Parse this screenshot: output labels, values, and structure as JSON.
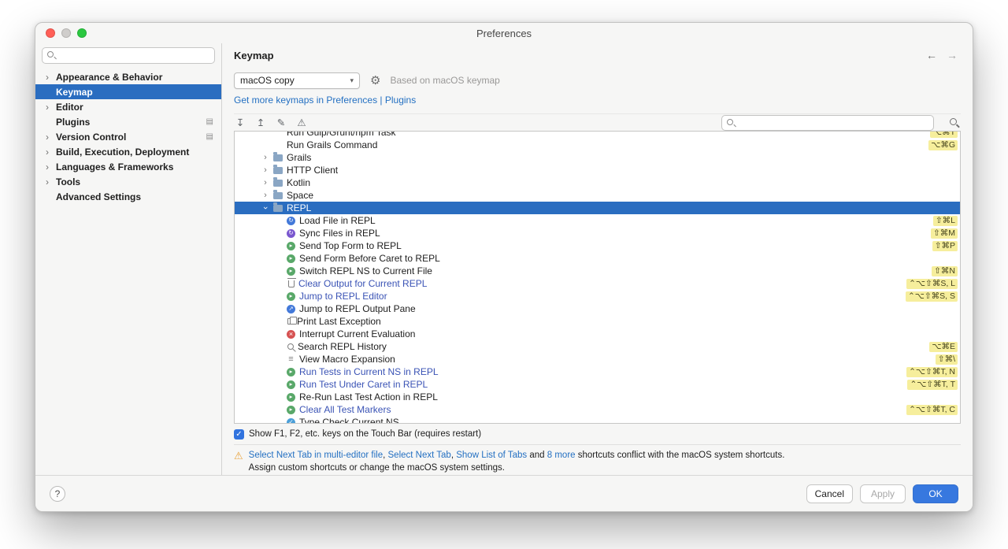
{
  "window": {
    "title": "Preferences"
  },
  "sidebar": {
    "search_placeholder": "",
    "items": [
      {
        "label": "Appearance & Behavior",
        "chevron": true,
        "selected": false
      },
      {
        "label": "Keymap",
        "chevron": false,
        "selected": true
      },
      {
        "label": "Editor",
        "chevron": true,
        "selected": false
      },
      {
        "label": "Plugins",
        "chevron": false,
        "selected": false,
        "trailing_icon": "plugin-list-icon"
      },
      {
        "label": "Version Control",
        "chevron": true,
        "selected": false,
        "trailing_icon": "plugin-list-icon"
      },
      {
        "label": "Build, Execution, Deployment",
        "chevron": true,
        "selected": false
      },
      {
        "label": "Languages & Frameworks",
        "chevron": true,
        "selected": false
      },
      {
        "label": "Tools",
        "chevron": true,
        "selected": false
      },
      {
        "label": "Advanced Settings",
        "chevron": false,
        "selected": false
      }
    ]
  },
  "header": {
    "title": "Keymap",
    "back_icon": "←",
    "forward_icon": "→"
  },
  "keymap": {
    "scheme": "macOS copy",
    "based_on": "Based on macOS keymap",
    "more_link": "Get more keymaps in Preferences | Plugins"
  },
  "toolbar": {
    "icons": [
      "expand-all",
      "collapse-all",
      "edit-shortcut",
      "show-conflicts"
    ],
    "search_placeholder": ""
  },
  "tree": {
    "rows": [
      {
        "kind": "action",
        "label": "Run Gulp/Grunt/npm Task",
        "shortcut": "⌥⌘T",
        "clipped": "top"
      },
      {
        "kind": "action",
        "label": "Run Grails Command",
        "shortcut": "⌥⌘G"
      },
      {
        "kind": "folder",
        "label": "Grails"
      },
      {
        "kind": "folder",
        "label": "HTTP Client"
      },
      {
        "kind": "folder",
        "label": "Kotlin"
      },
      {
        "kind": "folder",
        "label": "Space"
      },
      {
        "kind": "folder",
        "label": "REPL",
        "expanded": true,
        "selected": true
      },
      {
        "kind": "child",
        "icon": "repl-load",
        "label": "Load File in REPL",
        "shortcut": "⇧⌘L"
      },
      {
        "kind": "child",
        "icon": "repl-sync",
        "label": "Sync Files in REPL",
        "shortcut": "⇧⌘M"
      },
      {
        "kind": "child",
        "icon": "repl-run",
        "label": "Send Top Form to REPL",
        "shortcut": "⇧⌘P"
      },
      {
        "kind": "child",
        "icon": "repl-run",
        "label": "Send Form Before Caret to REPL"
      },
      {
        "kind": "child",
        "icon": "repl-run",
        "label": "Switch REPL NS to Current File",
        "shortcut": "⇧⌘N"
      },
      {
        "kind": "child",
        "icon": "trash",
        "label": "Clear Output for Current REPL",
        "shortcut": "⌃⌥⇧⌘S, L",
        "modified": true
      },
      {
        "kind": "child",
        "icon": "repl-run",
        "label": "Jump to REPL Editor",
        "shortcut": "⌃⌥⇧⌘S, S",
        "modified": true
      },
      {
        "kind": "child",
        "icon": "repl-jump",
        "label": "Jump to REPL Output Pane"
      },
      {
        "kind": "child",
        "icon": "copy",
        "label": "Print Last Exception"
      },
      {
        "kind": "child",
        "icon": "interrupt",
        "label": "Interrupt Current Evaluation"
      },
      {
        "kind": "child",
        "icon": "search",
        "label": "Search REPL History",
        "shortcut": "⌥⌘E"
      },
      {
        "kind": "child",
        "icon": "macro",
        "label": "View Macro Expansion",
        "shortcut": "⇧⌘\\"
      },
      {
        "kind": "child",
        "icon": "repl-run",
        "label": "Run Tests in Current NS in REPL",
        "shortcut": "⌃⌥⇧⌘T, N",
        "modified": true
      },
      {
        "kind": "child",
        "icon": "repl-run",
        "label": "Run Test Under Caret in REPL",
        "shortcut": "⌃⌥⇧⌘T, T",
        "modified": true
      },
      {
        "kind": "child",
        "icon": "repl-run",
        "label": "Re-Run Last Test Action in REPL"
      },
      {
        "kind": "child",
        "icon": "repl-run",
        "label": "Clear All Test Markers",
        "shortcut": "⌃⌥⇧⌘T, C",
        "modified": true
      },
      {
        "kind": "child",
        "icon": "repl-typecheck",
        "label": "Type Check Current NS",
        "clipped": "bottom"
      }
    ]
  },
  "touchbar": {
    "label": "Show F1, F2, etc. keys on the Touch Bar (requires restart)",
    "checked": true
  },
  "warning": {
    "segments": [
      {
        "text": "Select Next Tab in multi-editor file",
        "link": true
      },
      {
        "text": ", "
      },
      {
        "text": "Select Next Tab",
        "link": true
      },
      {
        "text": ", "
      },
      {
        "text": "Show List of Tabs",
        "link": true
      },
      {
        "text": " and "
      },
      {
        "text": "8 more",
        "link": true
      },
      {
        "text": " shortcuts conflict with the macOS system shortcuts."
      }
    ],
    "line2": "Assign custom shortcuts or change the macOS system settings."
  },
  "footer": {
    "help": "?",
    "cancel": "Cancel",
    "apply": "Apply",
    "ok": "OK"
  },
  "colors": {
    "selection_blue": "#2a6dc0",
    "link_blue": "#2470c2",
    "modified_action_blue": "#3a53b5",
    "shortcut_badge_yellow": "#f6ee9c",
    "primary_button_blue": "#3778df",
    "warning_orange": "#e9a23b",
    "checkbox_blue": "#3173de"
  }
}
